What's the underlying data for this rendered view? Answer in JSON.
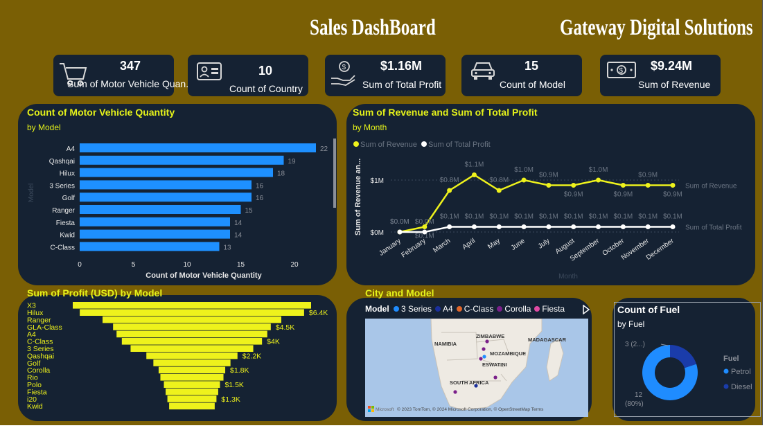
{
  "header": {
    "title": "Sales DashBoard",
    "company": "Gateway Digital Solutions"
  },
  "kpis": [
    {
      "value": "347",
      "label": "Sum of Motor Vehicle  Quan...",
      "icon": "shopping-cart-icon"
    },
    {
      "value": "10",
      "label": "Count of Country",
      "icon": "id-card-icon"
    },
    {
      "value": "$1.16M",
      "label": "Sum of Total Profit",
      "icon": "money-hand-icon"
    },
    {
      "value": "15",
      "label": "Count of Model",
      "icon": "car-icon"
    },
    {
      "value": "$9.24M",
      "label": "Sum of Revenue",
      "icon": "banknote-icon"
    }
  ],
  "colors": {
    "background": "#7a5f05",
    "panel": "#152233",
    "title": "#e5f21a",
    "bar_blue": "#1e90ff",
    "funnel_yellow": "#eef21c",
    "donut_petrol": "#1f8cff",
    "donut_diesel": "#1a3caa"
  },
  "vehicle_chart": {
    "title": "Count of Motor Vehicle Quantity",
    "subtitle": "by Model",
    "y_axis_label": "Model",
    "chart_data": {
      "type": "bar",
      "orientation": "horizontal",
      "categories": [
        "A4",
        "Qashqai",
        "Hilux",
        "3 Series",
        "Golf",
        "Ranger",
        "Fiesta",
        "Kwid",
        "C-Class"
      ],
      "values": [
        22,
        19,
        18,
        16,
        16,
        15,
        14,
        14,
        13
      ],
      "xlabel": "Count of Motor Vehicle Quantity",
      "xlim": [
        0,
        22
      ],
      "xticks": [
        "0",
        "5",
        "10",
        "15",
        "20"
      ]
    }
  },
  "revenue_chart": {
    "title": "Sum of Revenue and Sum of Total Profit",
    "subtitle": "by Month",
    "chart_data": {
      "type": "line",
      "x": [
        "January",
        "February",
        "March",
        "April",
        "May",
        "June",
        "July",
        "August",
        "September",
        "October",
        "November",
        "December"
      ],
      "series": [
        {
          "name": "Sum of Revenue",
          "values": [
            0.0,
            0.1,
            0.8,
            1.1,
            0.8,
            1.0,
            0.9,
            0.9,
            1.0,
            0.9,
            0.9,
            0.9
          ],
          "labels": [
            "$0.0M",
            "$0.1M",
            "$0.8M",
            "$1.1M",
            "$0.8M",
            "$1.0M",
            "$0.9M",
            "$0.9M",
            "$1.0M",
            "$0.9M",
            "$0.9M",
            "$0.9M"
          ],
          "color": "#eef21c"
        },
        {
          "name": "Sum of Total Profit",
          "values": [
            0.0,
            0.0,
            0.1,
            0.1,
            0.1,
            0.1,
            0.1,
            0.1,
            0.1,
            0.1,
            0.1,
            0.1
          ],
          "labels": [
            "$0.0M",
            "$0.0M",
            "$0.1M",
            "$0.1M",
            "$0.1M",
            "$0.1M",
            "$0.1M",
            "$0.1M",
            "$0.1M",
            "$0.1M",
            "$0.1M",
            "$0.1M"
          ],
          "color": "#ffffff"
        }
      ],
      "ylabel": "Sum of Revenue an...",
      "xlabel": "Month",
      "yticks": [
        "$0M",
        "$1M"
      ],
      "ylim": [
        0,
        1.4
      ],
      "line_end_labels": [
        "Sum of Revenue",
        "Sum of Total Profit"
      ]
    }
  },
  "profit_chart": {
    "title": "Sum of Profit (USD) by Model",
    "chart_data": {
      "type": "bar",
      "shape": "funnel",
      "categories": [
        "X3",
        "Hilux",
        "Ranger",
        "GLA-Class",
        "A4",
        "C-Class",
        "3 Series",
        "Qashqai",
        "Golf",
        "Corolla",
        "Rio",
        "Polo",
        "Fiesta",
        "i20",
        "Kwid"
      ],
      "values": [
        6.8,
        6.4,
        5.1,
        4.5,
        4.3,
        4.0,
        3.5,
        2.6,
        2.2,
        1.9,
        1.8,
        1.6,
        1.5,
        1.4,
        1.3
      ],
      "data_labels": [
        "",
        "$6.4K",
        "",
        "$4.5K",
        "",
        "$4K",
        "",
        "$2.2K",
        "",
        "$1.8K",
        "",
        "$1.5K",
        "",
        "$1.3K",
        ""
      ]
    }
  },
  "map": {
    "title": "City and Model",
    "legend_title": "Model",
    "legend": [
      {
        "label": "3 Series",
        "color": "#1f8cff"
      },
      {
        "label": "A4",
        "color": "#1a2f9c"
      },
      {
        "label": "C-Class",
        "color": "#e0662a"
      },
      {
        "label": "Corolla",
        "color": "#7a1f8a"
      },
      {
        "label": "Fiesta",
        "color": "#e04aa3"
      }
    ],
    "places": [
      "ZIMBABWE",
      "NAMIBIA",
      "MADAGASCAR",
      "MOZAMBIQUE",
      "ESWATINI",
      "SOUTH AFRICA"
    ],
    "attribution": "© 2023 TomTom, © 2024 Microsoft Corporation, © OpenStreetMap  Terms",
    "brand": "Microsoft"
  },
  "fuel_chart": {
    "title": "Count of Fuel",
    "subtitle": "by Fuel",
    "chart_data": {
      "type": "pie",
      "variant": "donut",
      "categories": [
        "Petrol",
        "Diesel"
      ],
      "values": [
        12,
        3
      ],
      "legend_title": "Fuel",
      "labels": [
        "12",
        "(80%)",
        "3 (2...)"
      ]
    }
  }
}
